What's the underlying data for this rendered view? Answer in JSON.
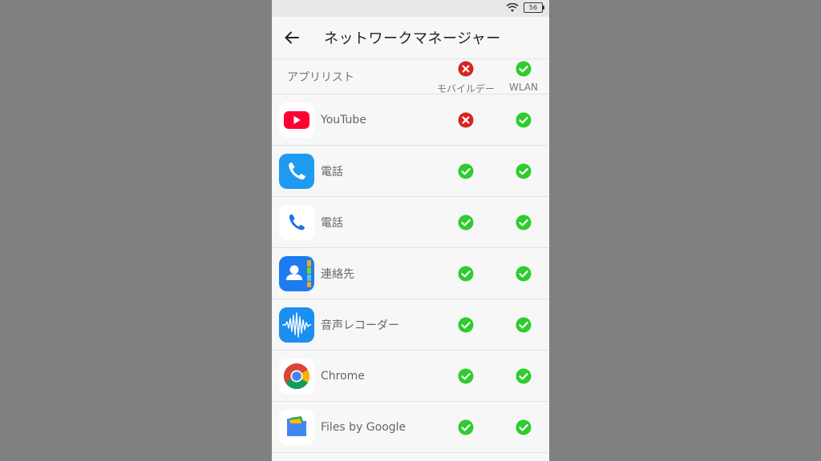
{
  "status": {
    "battery": "56"
  },
  "appbar": {
    "title": "ネットワークマネージャー"
  },
  "header": {
    "applist_label": "アプリリスト",
    "mobile_label": "モバイルデー",
    "wlan_label": "WLAN",
    "mobile_state": "blocked",
    "wlan_state": "allowed"
  },
  "apps": [
    {
      "name": "YouTube",
      "icon": "youtube-icon",
      "mobile": "blocked",
      "wlan": "allowed"
    },
    {
      "name": "電話",
      "icon": "phone-icon",
      "mobile": "allowed",
      "wlan": "allowed"
    },
    {
      "name": "電話",
      "icon": "google-phone-icon",
      "mobile": "allowed",
      "wlan": "allowed"
    },
    {
      "name": "連絡先",
      "icon": "contacts-icon",
      "mobile": "allowed",
      "wlan": "allowed"
    },
    {
      "name": "音声レコーダー",
      "icon": "voice-recorder-icon",
      "mobile": "allowed",
      "wlan": "allowed"
    },
    {
      "name": "Chrome",
      "icon": "chrome-icon",
      "mobile": "allowed",
      "wlan": "allowed"
    },
    {
      "name": "Files by Google",
      "icon": "files-icon",
      "mobile": "allowed",
      "wlan": "allowed"
    }
  ],
  "colors": {
    "allowed": "#2ecc2e",
    "blocked": "#d82323"
  }
}
